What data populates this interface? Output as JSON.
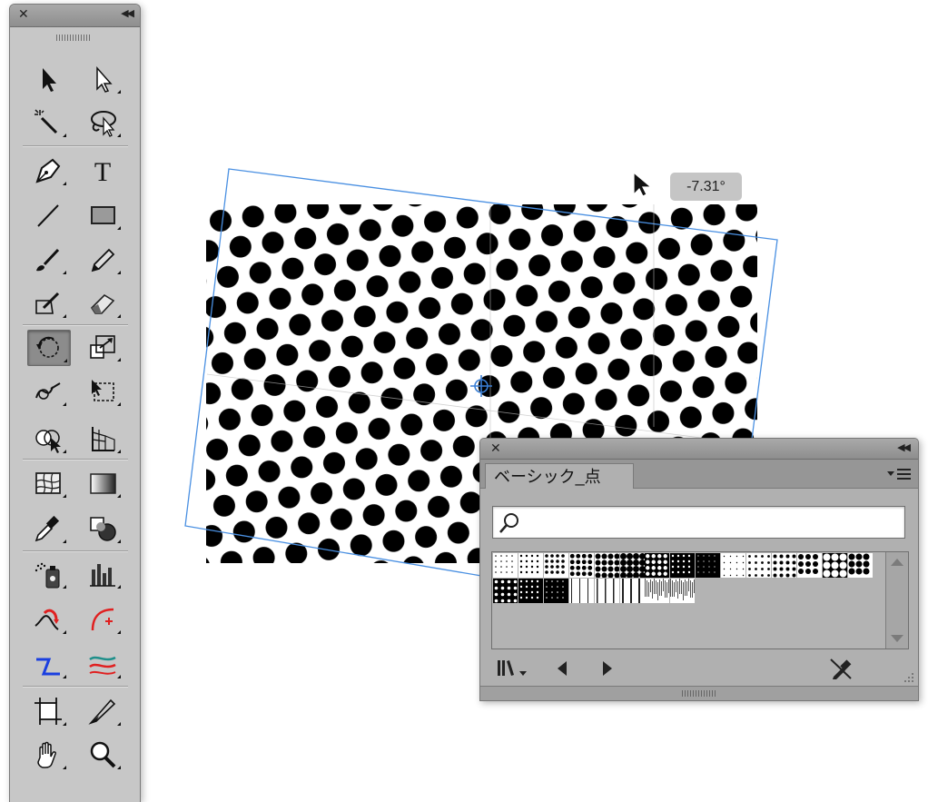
{
  "colors": {
    "selection_blue": "#4a90e2",
    "panel_bg": "#b0b0b0",
    "toolbox_bg": "#c7c7c7",
    "active_tool": "#8c8c8c"
  },
  "toolbox": {
    "tools": [
      {
        "name": "selection-tool-icon"
      },
      {
        "name": "direct-selection-tool-icon"
      },
      {
        "name": "magic-wand-tool-icon"
      },
      {
        "name": "lasso-tool-icon"
      },
      {
        "name": "pen-tool-icon"
      },
      {
        "name": "type-tool-icon"
      },
      {
        "name": "line-segment-tool-icon"
      },
      {
        "name": "rectangle-tool-icon"
      },
      {
        "name": "paintbrush-tool-icon"
      },
      {
        "name": "pencil-tool-icon"
      },
      {
        "name": "blob-brush-tool-icon"
      },
      {
        "name": "eraser-tool-icon"
      },
      {
        "name": "rotate-tool-icon",
        "active": true
      },
      {
        "name": "scale-tool-icon"
      },
      {
        "name": "warp-tool-icon"
      },
      {
        "name": "free-transform-tool-icon"
      },
      {
        "name": "shape-builder-tool-icon"
      },
      {
        "name": "perspective-grid-tool-icon"
      },
      {
        "name": "mesh-tool-icon"
      },
      {
        "name": "gradient-tool-icon"
      },
      {
        "name": "eyedropper-tool-icon"
      },
      {
        "name": "blend-tool-icon"
      },
      {
        "name": "symbol-sprayer-tool-icon"
      },
      {
        "name": "column-graph-tool-icon"
      },
      {
        "name": "width-tool-icon"
      },
      {
        "name": "curvature-tool-icon"
      },
      {
        "name": "join-tool-icon"
      },
      {
        "name": "puppet-warp-tool-icon"
      },
      {
        "name": "artboard-tool-icon"
      },
      {
        "name": "slice-tool-icon"
      },
      {
        "name": "hand-tool-icon"
      },
      {
        "name": "zoom-tool-icon"
      }
    ]
  },
  "canvas": {
    "rotation_readout": "-7.31°"
  },
  "swatch_panel": {
    "tab_title": "ベーシック_点",
    "search": {
      "value": "",
      "placeholder": ""
    },
    "footer": {
      "library_menu_icon": "swatch-library-menu-icon",
      "prev_icon": "previous-library-icon",
      "next_icon": "next-library-icon",
      "eyedropper_icon": "eyedropper-crossed-icon"
    }
  }
}
